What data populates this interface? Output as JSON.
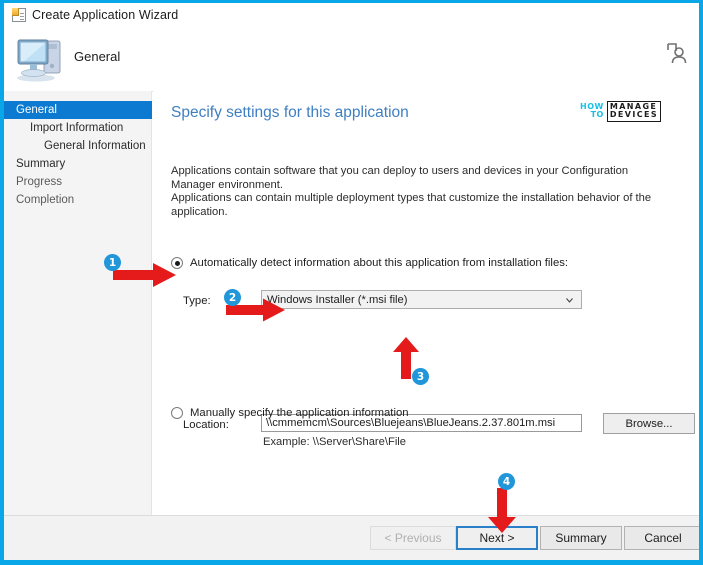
{
  "window": {
    "title": "Create Application Wizard",
    "title_icon": "wizard-app-icon",
    "header_page": "General",
    "header_icon": "computer-icon",
    "user_icon": "user-account-icon"
  },
  "sidebar": {
    "items": [
      {
        "label": "General",
        "level": 0,
        "state": "selected"
      },
      {
        "label": "Import Information",
        "level": 1,
        "state": "normal"
      },
      {
        "label": "General Information",
        "level": 2,
        "state": "normal"
      },
      {
        "label": "Summary",
        "level": 0,
        "state": "normal"
      },
      {
        "label": "Progress",
        "level": 0,
        "state": "muted"
      },
      {
        "label": "Completion",
        "level": 0,
        "state": "muted"
      }
    ]
  },
  "content": {
    "title": "Specify settings for this application",
    "description_line1": "Applications contain software that you can deploy to users and devices in your Configuration Manager environment.",
    "description_line2": "Applications can contain multiple deployment types that customize the installation behavior of the application.",
    "logo": {
      "how": "HOW",
      "to": "TO",
      "manage": "MANAGE",
      "devices": "DEVICES"
    },
    "radio_auto": {
      "label": "Automatically detect information about this application from installation files:",
      "checked": true
    },
    "radio_manual": {
      "label": "Manually specify the application information",
      "checked": false
    },
    "type_label": "Type:",
    "type_value": "Windows Installer (*.msi file)",
    "type_chevron": "chevron-down-icon",
    "location_label": "Location:",
    "location_value": "\\\\cmmemcm\\Sources\\Bluejeans\\BlueJeans.2.37.801m.msi",
    "example_text": "Example: \\\\Server\\Share\\File",
    "browse_label": "Browse..."
  },
  "footer": {
    "previous_label": "< Previous",
    "next_label": "Next >",
    "summary_label": "Summary",
    "cancel_label": "Cancel"
  },
  "callouts": {
    "badge1": "1",
    "badge2": "2",
    "badge3": "3",
    "badge4": "4"
  },
  "colors": {
    "screen_border": "#0aa7e8",
    "sidebar_selected": "#0b7ad0",
    "content_title": "#3f7fc1",
    "badge": "#2196d9",
    "arrow": "#e51b1b"
  }
}
